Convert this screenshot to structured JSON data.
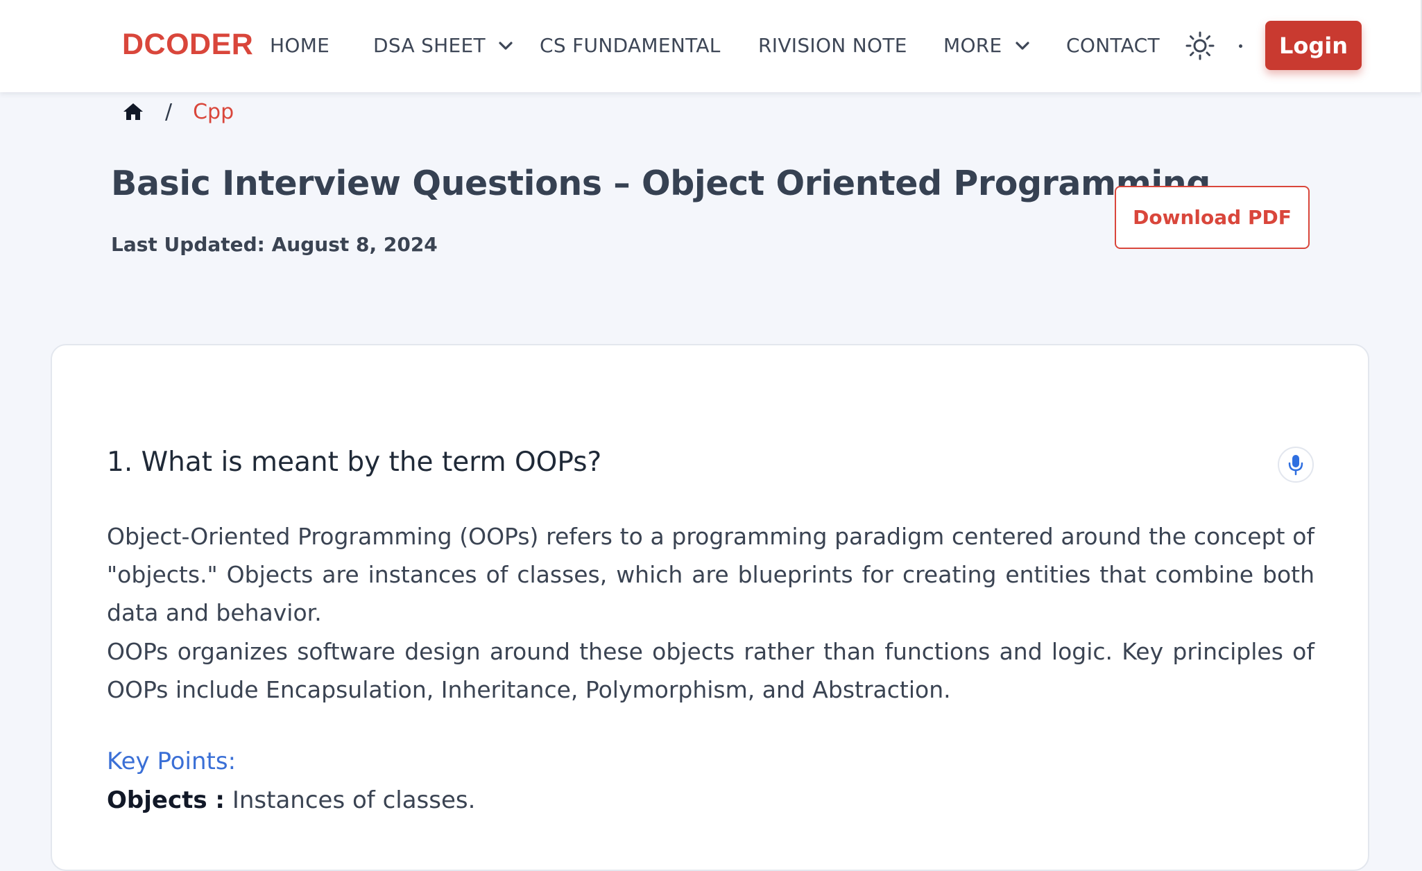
{
  "header": {
    "logo": "DCODER",
    "nav": [
      {
        "label": "HOME",
        "has_dropdown": false
      },
      {
        "label": "DSA SHEET",
        "has_dropdown": true
      },
      {
        "label": "CS FUNDAMENTAL",
        "has_dropdown": false
      },
      {
        "label": "RIVISION NOTE",
        "has_dropdown": false
      },
      {
        "label": "MORE",
        "has_dropdown": true
      },
      {
        "label": "CONTACT",
        "has_dropdown": false
      }
    ],
    "theme_icon": "sun-icon",
    "login_label": "Login"
  },
  "breadcrumb": {
    "home_icon": "home-icon",
    "separator": "/",
    "current": "Cpp"
  },
  "article": {
    "title": "Basic Interview Questions – Object Oriented Programming.",
    "last_updated": "Last Updated: August 8, 2024",
    "download_label": "Download PDF"
  },
  "card": {
    "question": "1. What is meant by the term OOPs?",
    "mic_icon": "microphone-icon",
    "paragraph1": "Object-Oriented Programming (OOPs) refers to a programming paradigm centered around the concept of \"objects.\" Objects are instances of classes, which are blueprints for creating entities that combine both data and behavior.",
    "paragraph2": "OOPs organizes software design around these objects rather than functions and logic. Key principles of OOPs include Encapsulation, Inheritance, Polymorphism, and Abstraction.",
    "key_points_heading": "Key Points:",
    "key_points": [
      {
        "term": "Objects :",
        "text": " Instances of classes."
      }
    ]
  },
  "colors": {
    "brand_red": "#d9463b",
    "login_bg": "#c93a30",
    "link_blue": "#3a6fd6",
    "page_bg": "#f4f6fb"
  }
}
